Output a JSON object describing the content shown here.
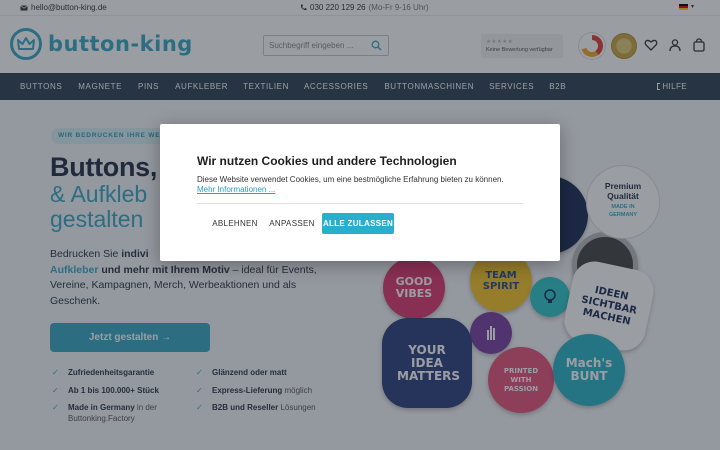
{
  "topbar": {
    "email": "hello@button-king.de",
    "phone": "030 220 129 26",
    "hours": "(Mo-Fr 9-16 Uhr)",
    "language": "DE"
  },
  "header": {
    "logo_text": "button-king",
    "search_placeholder": "Suchbegriff eingeben ...",
    "review_stars": "★★★★★",
    "review_text": "Keine Bewertung verfügbar"
  },
  "nav": {
    "items": [
      "BUTTONS",
      "MAGNETE",
      "PINS",
      "AUFKLEBER",
      "TEXTILIEN",
      "ACCESSORIES",
      "BUTTONMASCHINEN",
      "SERVICES",
      "B2B"
    ],
    "help": "HILFE"
  },
  "hero": {
    "tagline": "WIR BEDRUCKEN IHRE WE",
    "headline": "Buttons,",
    "subheadline_1": "& Aufkleb",
    "subheadline_2": "gestalten",
    "lead_1": "Bedrucken Sie ",
    "lead_2": "indivi",
    "lead_3": "Aufkleber",
    "lead_4": " und mehr mit Ihrem Motiv",
    "lead_5": " – ideal für Events, Vereine, Kampagnen, Merch, Werbeaktionen und als Geschenk.",
    "cta": "Jetzt gestalten →",
    "usps": [
      {
        "bold": "Zufriedenheitsgarantie",
        "light": ""
      },
      {
        "bold": "Glänzend oder matt",
        "light": ""
      },
      {
        "bold": "Ab 1 bis 100.000+ Stück",
        "light": ""
      },
      {
        "bold": "Express-Lieferung",
        "light": " möglich"
      },
      {
        "bold": "Made in Germany",
        "light": " in der Buttonking.Factory"
      },
      {
        "bold": "B2B und Reseller",
        "light": " Lösungen"
      }
    ],
    "quality_badge": {
      "line1": "Premium",
      "line2": "Qualität",
      "line3": "MADE IN",
      "line4": "GERMANY"
    },
    "buttons": {
      "good_vibes": "GOOD VIBES",
      "team_spirit": "TEAM SPIRIT",
      "ideen": "IDEEN SICHTBAR MACHEN",
      "your_idea": "YOUR IDEA MATTERS",
      "printed": "PRINTED WITH PASSION",
      "machs": "Mach's BUNT"
    }
  },
  "cookie": {
    "title": "Wir nutzen Cookies und andere Technologien",
    "body": "Diese Website verwendet Cookies, um eine bestmögliche Erfahrung bieten zu können. ",
    "link": "Mehr Informationen ...",
    "decline": "ABLEHNEN",
    "customize": "ANPASSEN",
    "accept": "ALLE ZULASSEN"
  },
  "colors": {
    "accent": "#3aa7c4",
    "nav_bg": "#2f3f52",
    "accept_button": "#2aaed0"
  }
}
